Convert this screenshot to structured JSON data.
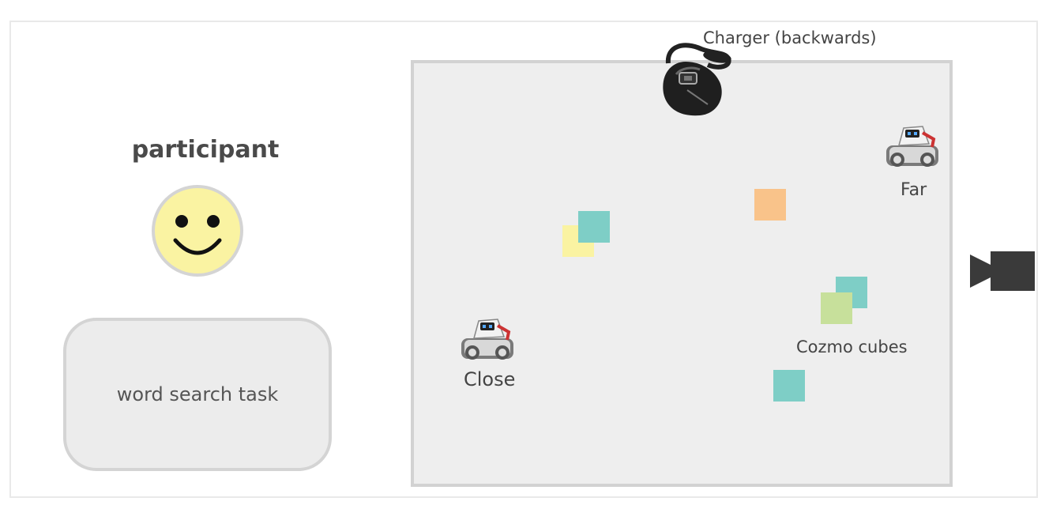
{
  "participant": {
    "label": "participant"
  },
  "task": {
    "label": "word search task"
  },
  "labels": {
    "charger": "Charger (backwards)",
    "far": "Far",
    "close": "Close",
    "cubes": "Cozmo cubes"
  },
  "icons": {
    "participant": "smiley-face-icon",
    "robot": "cozmo-robot-icon",
    "charger": "charger-icon",
    "camera": "video-camera-icon"
  },
  "colors": {
    "room_fill": "#eeeeee",
    "room_border": "#d2d2d2",
    "smiley_fill": "#faf3a2",
    "cube_teal": "#7ecec6",
    "cube_yellow": "#faf3a2",
    "cube_orange": "#f9c38a",
    "cube_green": "#c7e09b",
    "camera": "#3a3a3a"
  }
}
